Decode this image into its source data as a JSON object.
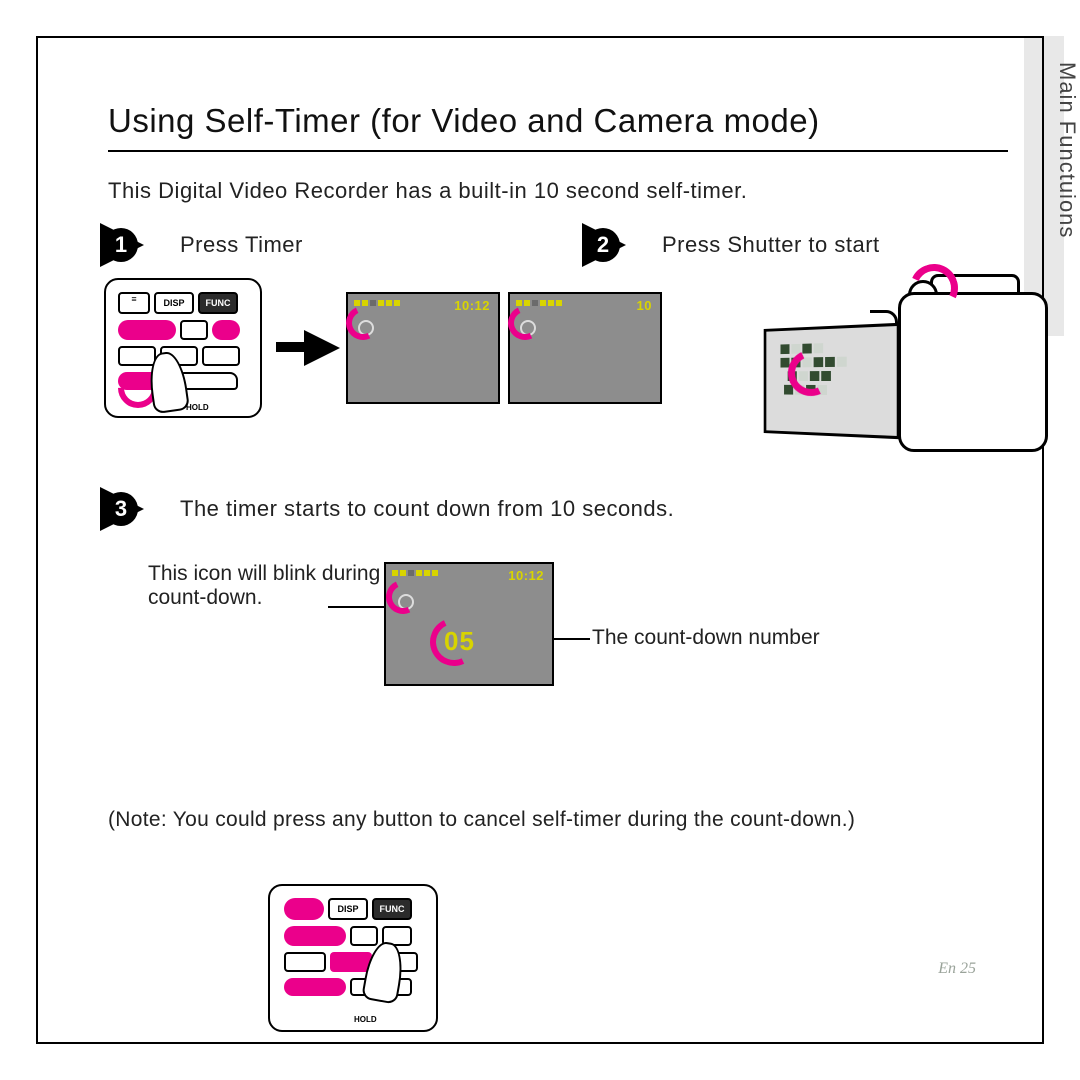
{
  "section_tab": "Main Functuions",
  "title": "Using Self-Timer (for Video and Camera mode)",
  "intro": "This Digital Video Recorder has a built-in 10 second self-timer.",
  "steps": {
    "step1": {
      "num": "1",
      "label": "Press Timer"
    },
    "step2": {
      "num": "2",
      "label": "Press Shutter to start"
    },
    "step3": {
      "num": "3",
      "label": "The timer starts to count down from 10 seconds."
    }
  },
  "lcd": {
    "time_a": "10:12",
    "time_b": "10",
    "time_c": "10:12",
    "count_c": "05"
  },
  "pad": {
    "disp": "DISP",
    "func": "FUNC",
    "hold": "HOLD"
  },
  "captions": {
    "blink": "This icon will blink during count-down.",
    "number": "The count-down number"
  },
  "note": "(Note: You could press any button to cancel self-timer during the count-down.)",
  "page_number": "En 25"
}
